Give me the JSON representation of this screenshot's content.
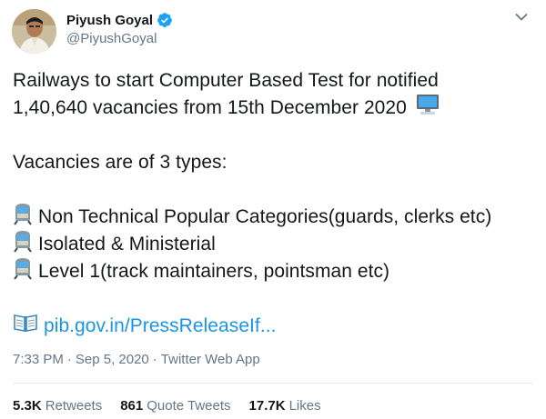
{
  "author": {
    "display_name": "Piyush Goyal",
    "handle": "@PiyushGoyal",
    "verified": true
  },
  "tweet": {
    "line1": "Railways to start Computer Based Test for notified",
    "line2": "1,40,640 vacancies from 15th December 2020",
    "line4": "Vacancies are of 3 types:",
    "items": [
      "Non Technical Popular Categories(guards, clerks etc)",
      "Isolated & Ministerial",
      "Level 1(track maintainers, pointsman etc)"
    ],
    "link_text": "pib.gov.in/PressReleaseIf..."
  },
  "meta": {
    "time": "7:33 PM",
    "date": "Sep 5, 2020",
    "separator": "·",
    "source": "Twitter Web App"
  },
  "stats": {
    "retweets_count": "5.3K",
    "retweets_label": "Retweets",
    "quotes_count": "861",
    "quotes_label": "Quote Tweets",
    "likes_count": "17.7K",
    "likes_label": "Likes"
  },
  "colors": {
    "link": "#1b95e0",
    "secondary_text": "#657786",
    "divider": "#e6ecf0",
    "verified": "#1da1f2"
  },
  "icons": {
    "verified": "verified-badge-icon",
    "computer": "desktop-computer-icon",
    "train": "train-icon",
    "book": "open-book-icon",
    "caret": "chevron-down-icon"
  }
}
